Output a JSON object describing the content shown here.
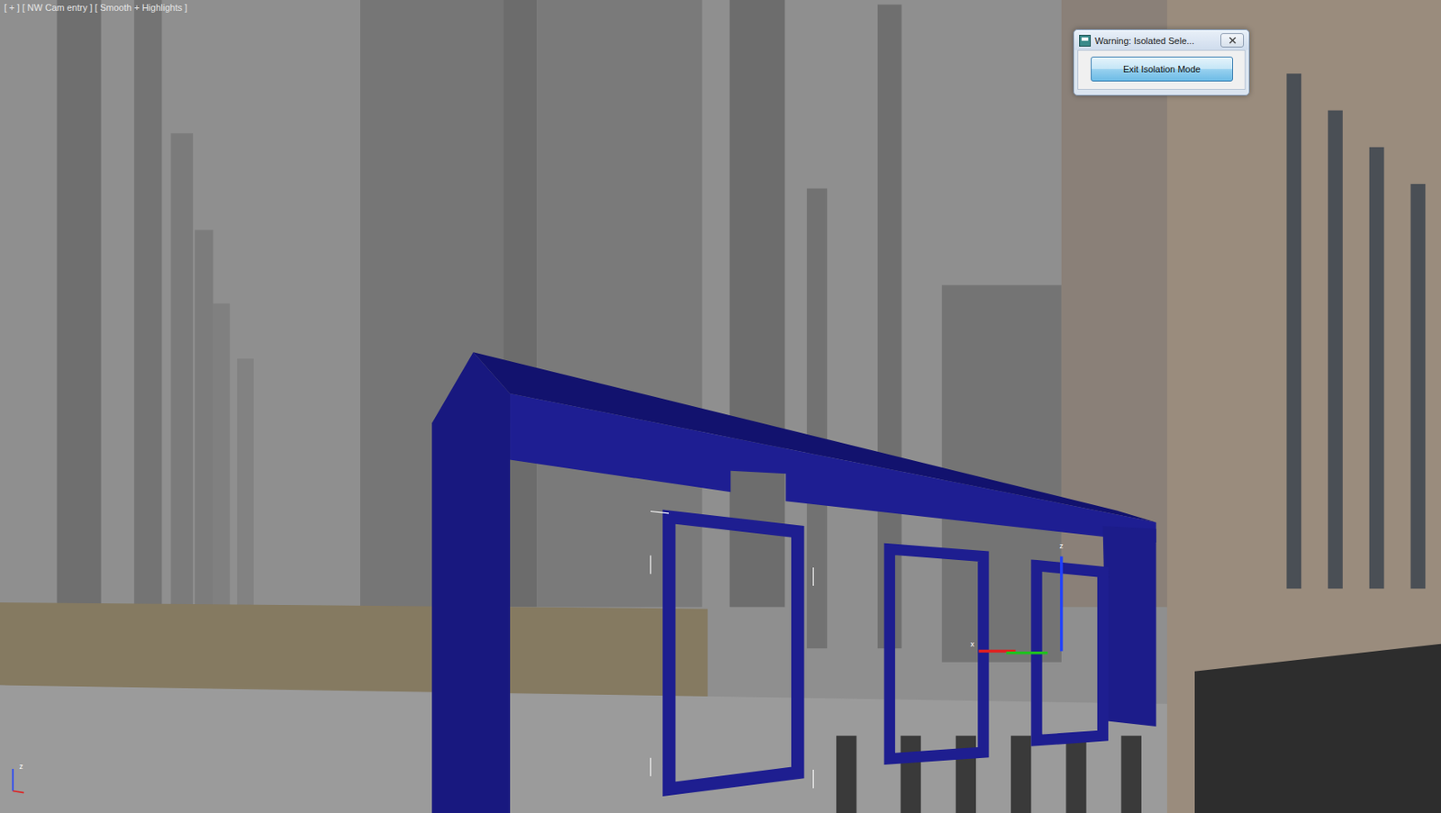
{
  "viewport": {
    "label": "[ + ] [ NW Cam entry ] [ Smooth + Highlights ]"
  },
  "dialog": {
    "title": "Warning: Isolated Sele...",
    "button": "Exit Isolation Mode"
  },
  "gizmo": {
    "x_label": "x",
    "z_label": "z"
  },
  "world_axis": {
    "z_label": "z"
  }
}
